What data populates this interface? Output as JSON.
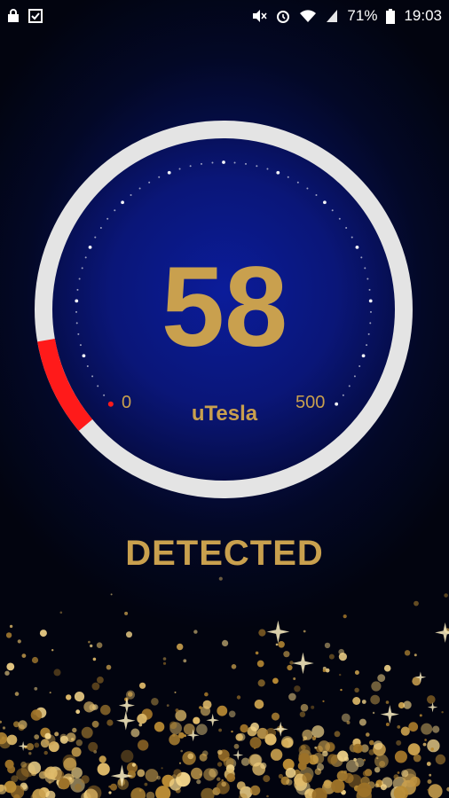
{
  "status_bar": {
    "battery": "71%",
    "time": "19:03",
    "left_icons": [
      "lock-icon",
      "checklist-icon"
    ],
    "right_icons": [
      "mute-icon",
      "alarm-icon",
      "wifi-icon",
      "signal-icon",
      "battery-icon"
    ]
  },
  "meter": {
    "value": "58",
    "unit": "uTesla",
    "scale_min": "0",
    "scale_max": "500",
    "fill_fraction": 0.116,
    "fill_color": "#ff1a1a",
    "track_color": "#e4e4e4",
    "dial_color": "#0a1678",
    "text_color": "#c9a04e"
  },
  "status": {
    "label": "DETECTED"
  }
}
